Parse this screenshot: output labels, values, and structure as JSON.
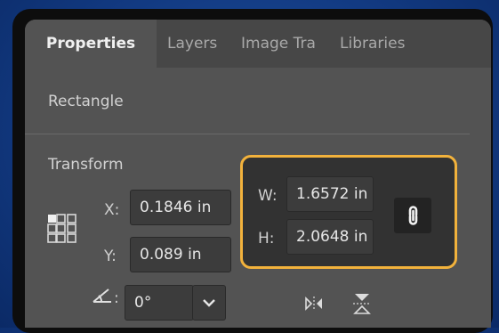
{
  "tabs": [
    {
      "label": "Properties",
      "active": true
    },
    {
      "label": "Layers",
      "active": false
    },
    {
      "label": "Image Tra",
      "active": false
    },
    {
      "label": "Libraries",
      "active": false
    }
  ],
  "object_type": "Rectangle",
  "transform": {
    "title": "Transform",
    "x_label": "X:",
    "x_value": "0.1846 in",
    "y_label": "Y:",
    "y_value": "0.089 in",
    "w_label": "W:",
    "w_value": "1.6572 in",
    "h_label": "H:",
    "h_value": "2.0648 in",
    "rotate_value": "0°"
  },
  "colors": {
    "highlight": "#f2b23c",
    "panel": "#535353",
    "field": "#3c3c3c"
  }
}
